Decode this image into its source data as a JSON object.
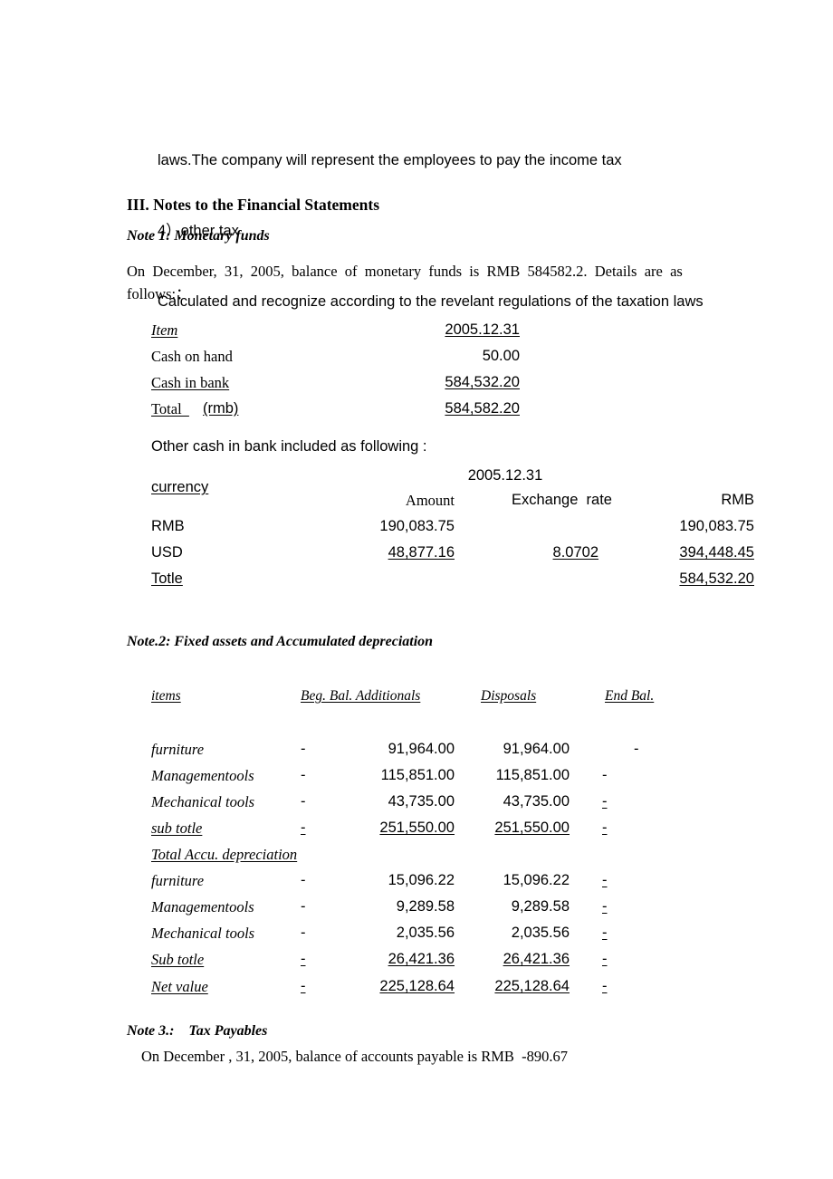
{
  "document": {
    "top_paragraph": [
      "laws.The company will represent the employees to pay the income tax",
      "4）other tax",
      "Calculated and recognize according to the revelant regulations of the taxation laws"
    ],
    "section_heading": "III. Notes to the Financial Statements"
  },
  "note1": {
    "heading": "Note 1: Monetary funds",
    "intro_line1": "On  December,  31,  2005,  balance  of  monetary  funds  is  RMB  584582.2.  Details  are  as",
    "intro_line2": "follows:：",
    "table": {
      "header": {
        "item": "Item",
        "date": "2005.12.31"
      },
      "rows": [
        {
          "label": "Cash on hand",
          "label_underline": false,
          "value": "50.00",
          "value_underline": false
        },
        {
          "label": "Cash in bank",
          "label_underline": true,
          "value": "584,532.20",
          "value_underline": true
        }
      ],
      "total": {
        "label": "Total  ",
        "label_suffix": "(rmb)",
        "value": "584,582.20"
      }
    },
    "sub_intro": "Other cash in bank included as following :",
    "fx_table": {
      "date": "2005.12.31",
      "header": {
        "currency": "currency",
        "amount": "Amount",
        "rate": "Exchange  rate",
        "rmb": "RMB"
      },
      "rows": [
        {
          "currency": "RMB",
          "amount": "190,083.75",
          "rate": "",
          "rmb": "190,083.75",
          "underline": false
        },
        {
          "currency": "USD",
          "amount": "48,877.16",
          "rate": "8.0702",
          "rmb": "394,448.45",
          "underline": true
        }
      ],
      "total": {
        "currency": "Totle",
        "amount": "",
        "rate": "",
        "rmb": "584,532.20"
      }
    }
  },
  "note2": {
    "heading": "Note.2: Fixed assets and Accumulated depreciation",
    "header": {
      "items": "items",
      "beg_bal_additionals": "Beg. Bal. Additionals",
      "disposals": "Disposals",
      "end_bal": "End Bal."
    },
    "fixed_assets": [
      {
        "label": "furniture",
        "beg": "-",
        "additionals": "91,964.00",
        "disposals": "91,964.00",
        "end": "-",
        "underline": false
      },
      {
        "label": "Managementools",
        "beg": "-",
        "additionals": "115,851.00",
        "disposals": "115,851.00",
        "end": "-",
        "underline": false
      },
      {
        "label": "Mechanical tools",
        "beg": "-",
        "additionals": "43,735.00",
        "disposals": "43,735.00",
        "end": "-",
        "underline": false
      }
    ],
    "fixed_assets_subtotal": {
      "label": "sub totle",
      "beg": "-",
      "additionals": "251,550.00",
      "disposals": "251,550.00",
      "end": "-"
    },
    "depreciation_heading": "Total Accu. depreciation",
    "depreciation": [
      {
        "label": "furniture",
        "beg": "-",
        "additionals": "15,096.22",
        "disposals": "15,096.22",
        "end": "-"
      },
      {
        "label": "Managementools",
        "beg": "-",
        "additionals": "9,289.58",
        "disposals": "9,289.58",
        "end": "-"
      },
      {
        "label": "Mechanical tools",
        "beg": "-",
        "additionals": "2,035.56",
        "disposals": "2,035.56",
        "end": "-"
      }
    ],
    "depreciation_subtotal": {
      "label": "Sub totle",
      "beg": "-",
      "additionals": "26,421.36",
      "disposals": "26,421.36",
      "end": "-"
    },
    "net_value": {
      "label": "Net value",
      "beg": "-",
      "additionals": "225,128.64",
      "disposals": "225,128.64",
      "end": "-"
    }
  },
  "note3": {
    "heading": "Note 3.:    Tax Payables",
    "body": "On December , 31, 2005, balance of accounts payable is RMB  -890.67"
  }
}
